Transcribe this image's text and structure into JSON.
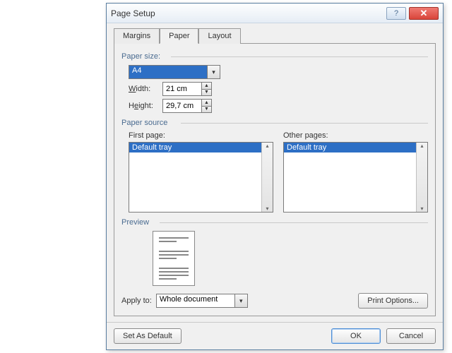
{
  "title": "Page Setup",
  "tabs": {
    "margins": "Margins",
    "paper": "Paper",
    "layout": "Layout",
    "active": "Paper"
  },
  "paper_size": {
    "label": "Paper size:",
    "selected": "A4",
    "width_label": "Width:",
    "width_value": "21 cm",
    "height_label": "Height:",
    "height_value": "29,7 cm"
  },
  "paper_source": {
    "label": "Paper source",
    "first_page_label": "First page:",
    "first_page_selected": "Default tray",
    "other_pages_label": "Other pages:",
    "other_pages_selected": "Default tray"
  },
  "preview": {
    "label": "Preview"
  },
  "apply_to": {
    "label": "Apply to:",
    "value": "Whole document"
  },
  "print_options": "Print Options...",
  "buttons": {
    "set_default": "Set As Default",
    "ok": "OK",
    "cancel": "Cancel"
  }
}
